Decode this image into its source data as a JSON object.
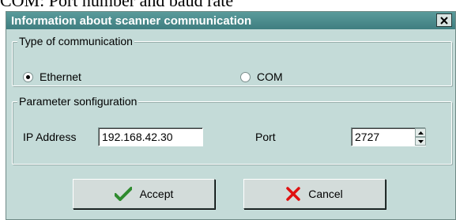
{
  "caption": "COM: Port number and baud rate",
  "dialog": {
    "title": "Information about scanner communication",
    "close_icon": "close-x-icon"
  },
  "comm_type": {
    "legend": "Type of communication",
    "options": [
      {
        "label": "Ethernet",
        "selected": true
      },
      {
        "label": "COM",
        "selected": false
      }
    ]
  },
  "params": {
    "legend": "Parameter sonfiguration",
    "ip_label": "IP Address",
    "ip_value": "192.168.42.30",
    "port_label": "Port",
    "port_value": "2727"
  },
  "buttons": {
    "accept": {
      "label": "Accept",
      "icon": "checkmark-icon",
      "icon_color": "#2e8b2e"
    },
    "cancel": {
      "label": "Cancel",
      "icon": "red-x-icon",
      "icon_color": "#e01010"
    }
  }
}
